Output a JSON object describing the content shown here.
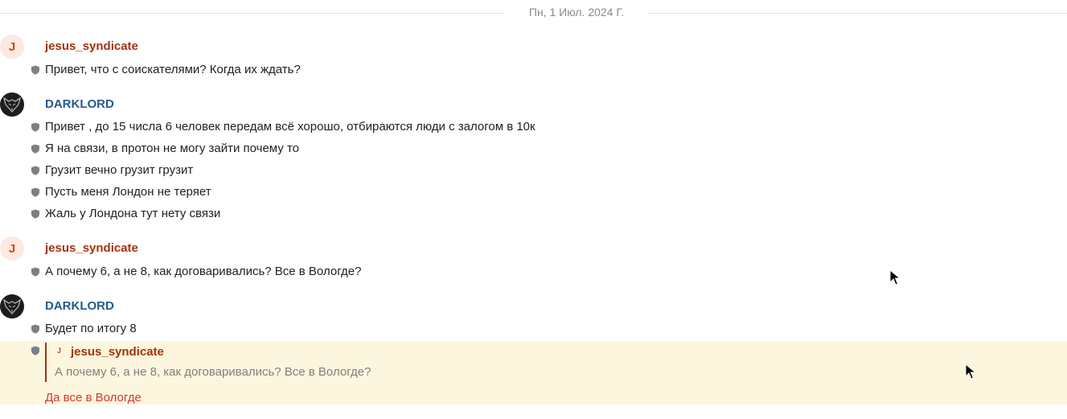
{
  "date_separator": "Пн, 1 Июл. 2024 Г.",
  "colors": {
    "author_red": "#a2330f",
    "author_blue": "#235a8c",
    "highlight_bg": "#fdf6de",
    "reply_text": "#d13b2b"
  },
  "groups": [
    {
      "author": "jesus_syndicate",
      "avatar_letter": "J",
      "messages": [
        "Привет, что с соискателями? Когда их ждать?"
      ]
    },
    {
      "author": "DARKLORD",
      "avatar_icon": "fox-mask-icon",
      "messages": [
        "Привет , до 15 числа 6 человек передам всё хорошо, отбираются люди с залогом в 10к",
        "Я на связи, в протон не могу зайти почему то",
        "Грузит вечно грузит грузит",
        "Пусть меня Лондон не теряет",
        "Жаль у Лондона тут нету связи"
      ]
    },
    {
      "author": "jesus_syndicate",
      "avatar_letter": "J",
      "messages": [
        "А почему 6, а не 8, как договаривались? Все в Вологде?"
      ]
    },
    {
      "author": "DARKLORD",
      "avatar_icon": "fox-mask-icon",
      "messages": [
        "Будет по итогу 8"
      ]
    }
  ],
  "quoted_reply": {
    "avatar_letter": "J",
    "quoted_author": "jesus_syndicate",
    "quoted_text": "А почему 6, а не 8, как договаривались? Все в Вологде?",
    "reply_text": "Да все в Вологде"
  }
}
